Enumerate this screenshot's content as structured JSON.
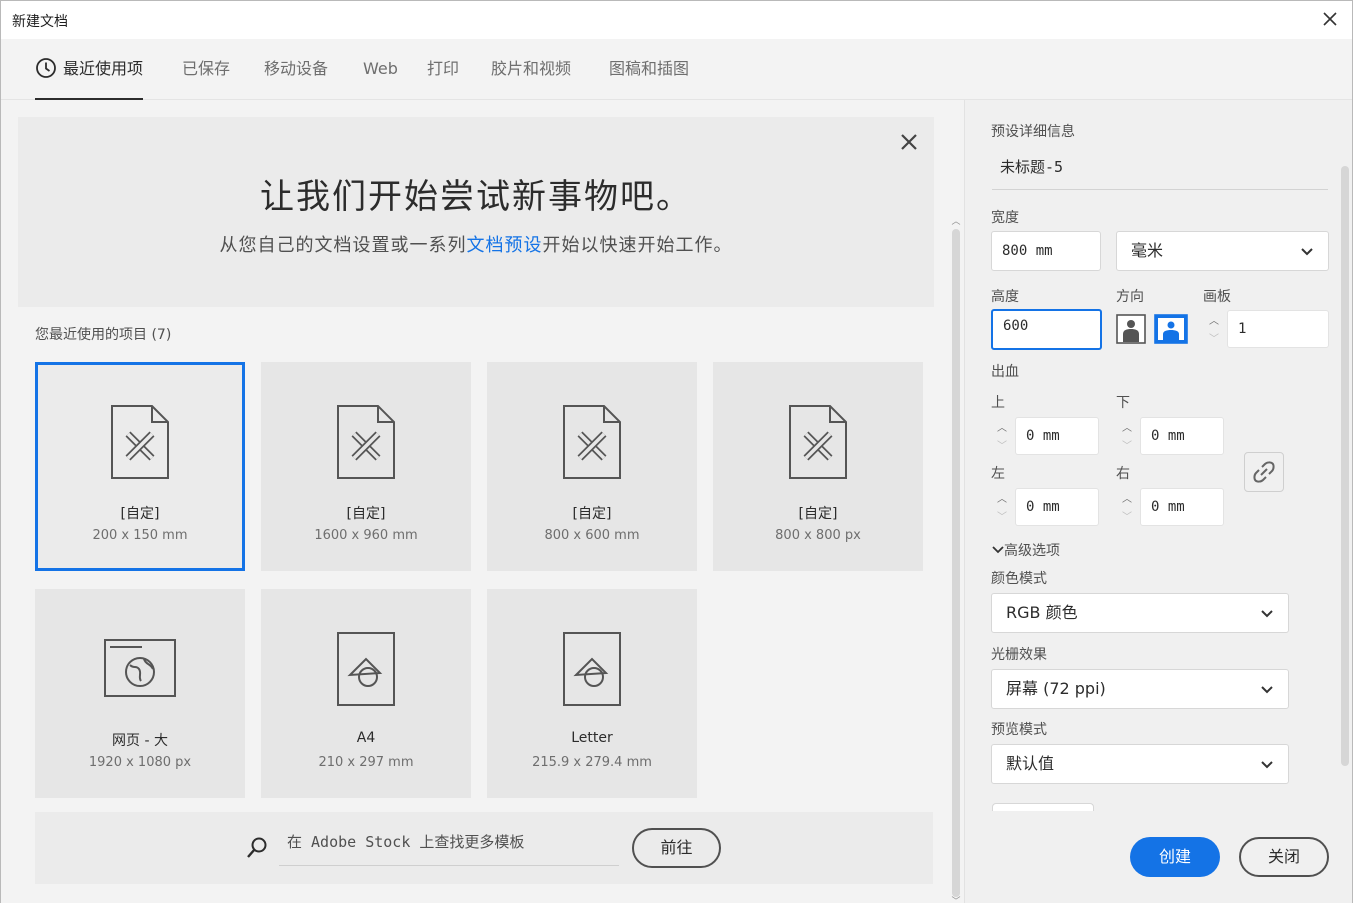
{
  "window": {
    "title": "新建文档"
  },
  "tabs": [
    {
      "label": "最近使用项",
      "active": true
    },
    {
      "label": "已保存"
    },
    {
      "label": "移动设备"
    },
    {
      "label": "Web"
    },
    {
      "label": "打印"
    },
    {
      "label": "胶片和视频"
    },
    {
      "label": "图稿和插图"
    }
  ],
  "hero": {
    "headline": "让我们开始尝试新事物吧。",
    "sub_before": "从您自己的文档设置或一系列",
    "sub_link": "文档预设",
    "sub_after": "开始以快速开始工作。"
  },
  "recent": {
    "title": "您最近使用的项目 (7)",
    "items": [
      {
        "name": "[自定]",
        "size": "200 x 150 mm",
        "icon": "custom-document-icon"
      },
      {
        "name": "[自定]",
        "size": "1600 x 960 mm",
        "icon": "custom-document-icon"
      },
      {
        "name": "[自定]",
        "size": "800 x 600 mm",
        "icon": "custom-document-icon"
      },
      {
        "name": "[自定]",
        "size": "800 x 800 px",
        "icon": "custom-document-icon"
      },
      {
        "name": "网页 - 大",
        "size": "1920 x 1080 px",
        "icon": "web-globe-icon"
      },
      {
        "name": "A4",
        "size": "210 x 297 mm",
        "icon": "print-shapes-icon"
      },
      {
        "name": "Letter",
        "size": "215.9 x 279.4 mm",
        "icon": "print-shapes-icon"
      }
    ]
  },
  "stock": {
    "placeholder": "在 Adobe Stock 上查找更多模板",
    "go_label": "前往"
  },
  "details": {
    "section_title": "预设详细信息",
    "doc_name": "未标题-5",
    "width_label": "宽度",
    "width_value": "800 mm",
    "unit_value": "毫米",
    "height_label": "高度",
    "height_value": "600",
    "orientation_label": "方向",
    "artboards_label": "画板",
    "artboards_value": "1",
    "bleed_label": "出血",
    "bleed_top_label": "上",
    "bleed_top_value": "0 mm",
    "bleed_bottom_label": "下",
    "bleed_bottom_value": "0 mm",
    "bleed_left_label": "左",
    "bleed_left_value": "0 mm",
    "bleed_right_label": "右",
    "bleed_right_value": "0 mm",
    "advanced_label": "高级选项",
    "color_mode_label": "颜色模式",
    "color_mode_value": "RGB 颜色",
    "raster_label": "光栅效果",
    "raster_value": "屏幕 (72 ppi)",
    "preview_label": "预览模式",
    "preview_value": "默认值"
  },
  "actions": {
    "create_label": "创建",
    "close_label": "关闭"
  },
  "colors": {
    "accent": "#1473e6",
    "panel_bg": "#f3f3f3",
    "card_bg": "#e6e6e6"
  }
}
